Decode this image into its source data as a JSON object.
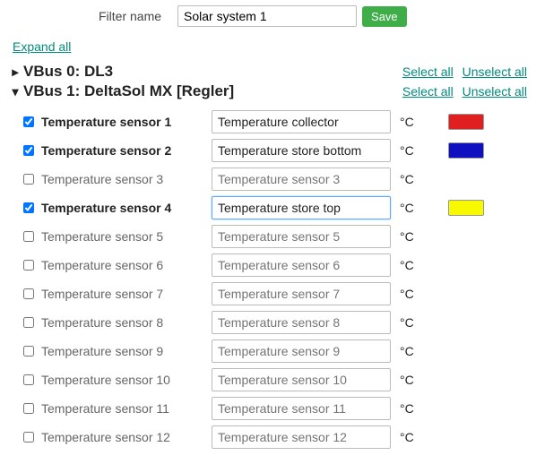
{
  "filter": {
    "label": "Filter name",
    "value": "Solar system 1",
    "save": "Save"
  },
  "expand_all": "Expand all",
  "links": {
    "select_all": "Select all",
    "unselect_all": "Unselect all"
  },
  "groups": [
    {
      "id": "vbus0",
      "expanded": false,
      "title": "VBus 0: DL3"
    },
    {
      "id": "vbus1",
      "expanded": true,
      "title": "VBus 1: DeltaSol MX [Regler]"
    }
  ],
  "unit": "°C",
  "sensors": [
    {
      "checked": true,
      "label": "Temperature sensor 1",
      "value": "Temperature collector",
      "placeholder": "",
      "color": "#e02020",
      "focused": false
    },
    {
      "checked": true,
      "label": "Temperature sensor 2",
      "value": "Temperature store bottom",
      "placeholder": "",
      "color": "#1010c0",
      "focused": false
    },
    {
      "checked": false,
      "label": "Temperature sensor 3",
      "value": "",
      "placeholder": "Temperature sensor 3",
      "color": "",
      "focused": false
    },
    {
      "checked": true,
      "label": "Temperature sensor 4",
      "value": "Temperature store top",
      "placeholder": "",
      "color": "#f8f800",
      "focused": true
    },
    {
      "checked": false,
      "label": "Temperature sensor 5",
      "value": "",
      "placeholder": "Temperature sensor 5",
      "color": "",
      "focused": false
    },
    {
      "checked": false,
      "label": "Temperature sensor 6",
      "value": "",
      "placeholder": "Temperature sensor 6",
      "color": "",
      "focused": false
    },
    {
      "checked": false,
      "label": "Temperature sensor 7",
      "value": "",
      "placeholder": "Temperature sensor 7",
      "color": "",
      "focused": false
    },
    {
      "checked": false,
      "label": "Temperature sensor 8",
      "value": "",
      "placeholder": "Temperature sensor 8",
      "color": "",
      "focused": false
    },
    {
      "checked": false,
      "label": "Temperature sensor 9",
      "value": "",
      "placeholder": "Temperature sensor 9",
      "color": "",
      "focused": false
    },
    {
      "checked": false,
      "label": "Temperature sensor 10",
      "value": "",
      "placeholder": "Temperature sensor 10",
      "color": "",
      "focused": false
    },
    {
      "checked": false,
      "label": "Temperature sensor 11",
      "value": "",
      "placeholder": "Temperature sensor 11",
      "color": "",
      "focused": false
    },
    {
      "checked": false,
      "label": "Temperature sensor 12",
      "value": "",
      "placeholder": "Temperature sensor 12",
      "color": "",
      "focused": false
    }
  ]
}
